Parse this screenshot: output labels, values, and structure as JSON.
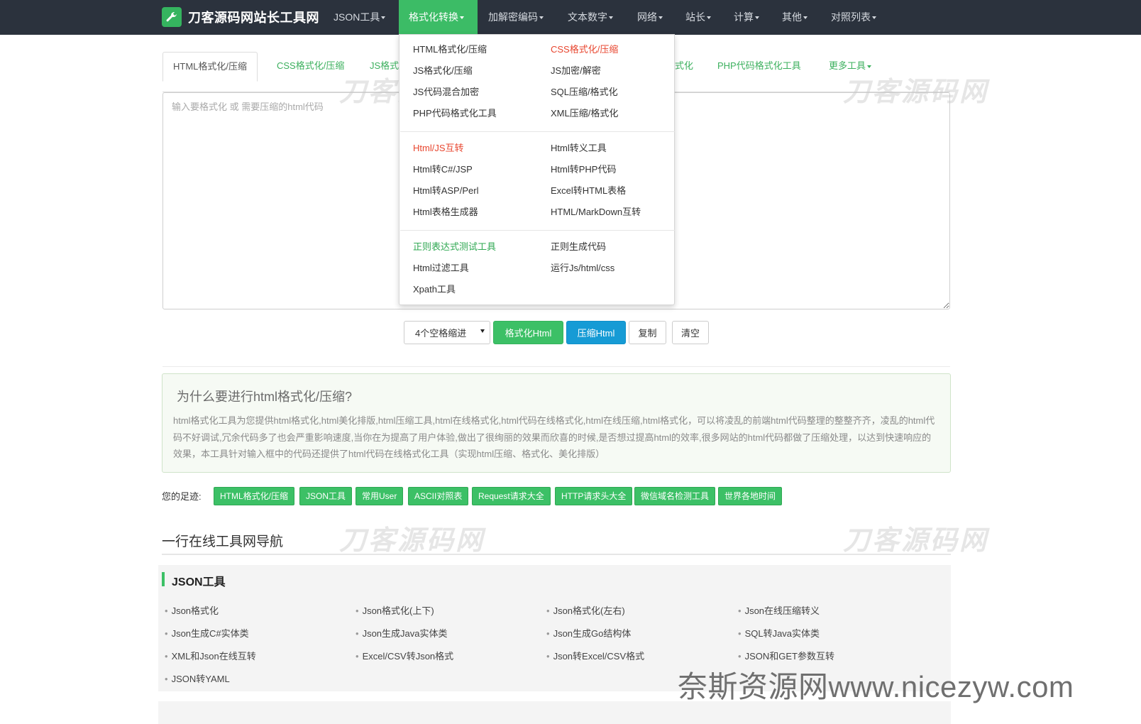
{
  "navbar": {
    "brand": "刀客源码网站长工具网",
    "items": [
      {
        "label": "JSON工具"
      },
      {
        "label": "格式化转换"
      },
      {
        "label": "加解密编码"
      },
      {
        "label": "文本数字"
      },
      {
        "label": "网络"
      },
      {
        "label": "站长"
      },
      {
        "label": "计算"
      },
      {
        "label": "其他"
      },
      {
        "label": "对照列表"
      }
    ],
    "active_index": 1,
    "bg_color": "#2b323d",
    "accent_color": "#3cbc66"
  },
  "tabs": [
    {
      "label": "HTML格式化/压缩",
      "active": true
    },
    {
      "label": "CSS格式化/压缩"
    },
    {
      "label": "JS格式"
    },
    {
      "label": "式化"
    },
    {
      "label": "PHP代码格式化工具"
    },
    {
      "label": "更多工具"
    }
  ],
  "editor": {
    "placeholder": "输入要格式化 或 需要压缩的html代码",
    "value": ""
  },
  "controls": {
    "indent_select": "4个空格缩进",
    "format_button": "格式化Html",
    "compress_button": "压缩Html",
    "copy_button": "复制",
    "clear_button": "清空"
  },
  "info": {
    "title": "为什么要进行html格式化/压缩?",
    "body": "html格式化工具为您提供html格式化,html美化排版,html压缩工具,html在线格式化,html代码在线格式化,html在线压缩,html格式化，可以将凌乱的前端html代码整理的整整齐齐，凌乱的html代码不好调试,冗余代码多了也会严重影响速度,当你在为提高了用户体验,做出了很绚丽的效果而欣喜的时候,是否想过提高html的效率,很多网站的html代码都做了压缩处理，以达到快速响应的效果，本工具针对输入框中的代码还提供了html代码在线格式化工具（实现html压缩、格式化、美化排版）"
  },
  "footprint": {
    "label": "您的足迹:",
    "chips": [
      "HTML格式化/压缩",
      "JSON工具",
      "常用User",
      "ASCII对照表",
      "Request请求大全",
      "HTTP请求头大全",
      "微信域名检测工具",
      "世界各地时间"
    ]
  },
  "nav_heading": "一行在线工具网导航",
  "json_section": {
    "title": "JSON工具",
    "links": [
      "Json格式化",
      "Json格式化(上下)",
      "Json格式化(左右)",
      "Json在线压缩转义",
      "Json生成C#实体类",
      "Json生成Java实体类",
      "Json生成Go结构体",
      "SQL转Java实体类",
      "XML和Json在线互转",
      "Excel/CSV转Json格式",
      "Json转Excel/CSV格式",
      "JSON和GET参数互转",
      "JSON转YAML"
    ]
  },
  "dropdown": {
    "groups": [
      [
        {
          "label": "HTML格式化/压缩"
        },
        {
          "label": "CSS格式化/压缩",
          "color": "red"
        },
        {
          "label": "JS格式化/压缩"
        },
        {
          "label": "JS加密/解密"
        },
        {
          "label": "JS代码混合加密"
        },
        {
          "label": "SQL压缩/格式化"
        },
        {
          "label": "PHP代码格式化工具"
        },
        {
          "label": "XML压缩/格式化"
        }
      ],
      [
        {
          "label": "Html/JS互转",
          "color": "red"
        },
        {
          "label": "Html转义工具"
        },
        {
          "label": "Html转C#/JSP"
        },
        {
          "label": "Html转PHP代码"
        },
        {
          "label": "Html转ASP/Perl"
        },
        {
          "label": "Excel转HTML表格"
        },
        {
          "label": "Html表格生成器"
        },
        {
          "label": "HTML/MarkDown互转"
        }
      ],
      [
        {
          "label": "正则表达式测试工具",
          "color": "green"
        },
        {
          "label": "正则生成代码"
        },
        {
          "label": "Html过滤工具"
        },
        {
          "label": "运行Js/html/css"
        },
        {
          "label": "Xpath工具"
        }
      ]
    ]
  },
  "watermarks": {
    "logo_text": "刀客源码网",
    "bottom_text": "奈斯资源网www.nicezyw.com"
  }
}
